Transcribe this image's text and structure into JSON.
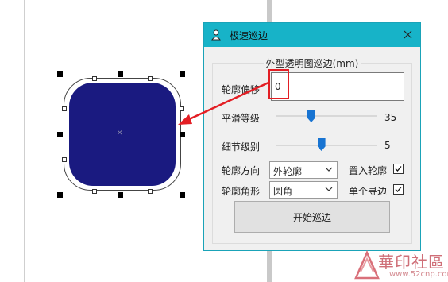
{
  "dialog": {
    "title": "极速巡边",
    "group_title": "外型透明图巡边(mm)",
    "offset": {
      "label": "轮廓偏移",
      "value": "0"
    },
    "smooth": {
      "label": "平滑等级",
      "value": "35",
      "level": 0.35
    },
    "detail": {
      "label": "细节级别",
      "value": "5",
      "level": 0.45
    },
    "direction": {
      "label": "轮廓方向",
      "selected": "外轮廓"
    },
    "corner": {
      "label": "轮廓角形",
      "selected": "圆角"
    },
    "place_outline": {
      "label": "置入轮廓",
      "checked": true
    },
    "single_path": {
      "label": "单个寻边",
      "checked": true
    },
    "start_button": "开始巡边"
  },
  "watermark": {
    "text": "華印社區",
    "url": "www.52cnp.com"
  },
  "colors": {
    "titlebar": "#17b3c8",
    "shape_fill": "#1a1a80",
    "highlight": "#e31e24",
    "slider": "#1874d2"
  }
}
